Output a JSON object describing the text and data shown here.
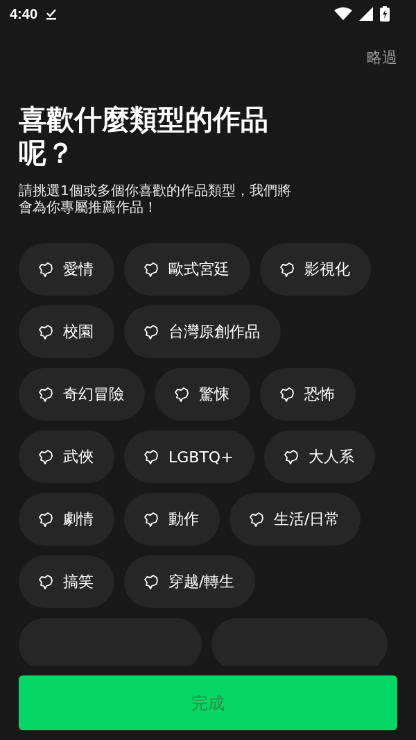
{
  "status_bar": {
    "time": "4:40"
  },
  "skip": "略過",
  "title": "喜歡什麼類型的作品呢？",
  "subtitle": "請挑選1個或多個你喜歡的作品類型，我們將會為你專屬推薦作品！",
  "genres": [
    {
      "label": "愛情",
      "selected": false
    },
    {
      "label": "歐式宮廷",
      "selected": false
    },
    {
      "label": "影視化",
      "selected": false
    },
    {
      "label": "校園",
      "selected": false
    },
    {
      "label": "台灣原創作品",
      "selected": false
    },
    {
      "label": "奇幻冒險",
      "selected": false
    },
    {
      "label": "驚悚",
      "selected": false
    },
    {
      "label": "恐怖",
      "selected": false
    },
    {
      "label": "武俠",
      "selected": false
    },
    {
      "label": "LGBTQ+",
      "selected": false
    },
    {
      "label": "大人系",
      "selected": false
    },
    {
      "label": "劇情",
      "selected": false
    },
    {
      "label": "動作",
      "selected": false
    },
    {
      "label": "生活/日常",
      "selected": false
    },
    {
      "label": "搞笑",
      "selected": false
    },
    {
      "label": "穿越/轉生",
      "selected": false
    }
  ],
  "cut_off_chips": [
    {
      "kind": "chip"
    },
    {
      "kind": "chip"
    }
  ],
  "done_button": {
    "label": "完成",
    "disabled": true
  }
}
